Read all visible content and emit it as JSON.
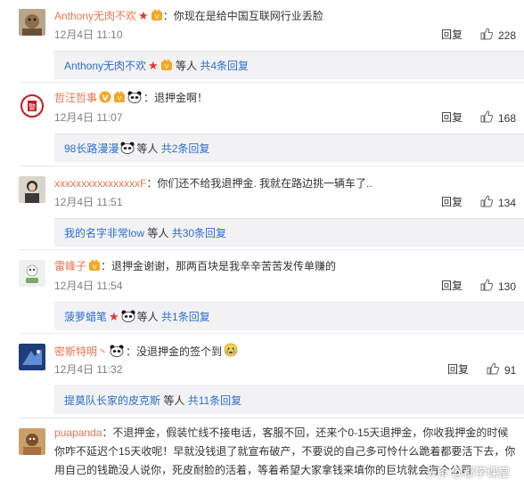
{
  "colors": {
    "username": "#eb7350",
    "link": "#2d6ec8",
    "meta": "#808080",
    "subbox_bg": "#f2f2f5"
  },
  "comments": [
    {
      "username": "Anthony无肉不欢",
      "text": "：你现在是给中国互联网行业丢脸",
      "time": "12月4日 11:10",
      "reply": "回复",
      "likes": "228",
      "sub": {
        "who": "Anthony无肉不欢",
        "etc": " 等人 ",
        "count": "共4条回复"
      }
    },
    {
      "username": "哲汪哲事",
      "text": "：退押金啊！",
      "time": "12月4日 11:07",
      "reply": "回复",
      "likes": "168",
      "sub": {
        "who": "98长路漫漫",
        "etc": "等人 ",
        "count": "共2条回复"
      }
    },
    {
      "username": "xxxxxxxxxxxxxxxxF",
      "text": "：你们还不给我退押金. 我就在路边挑一辆车了..",
      "time": "12月4日 11:51",
      "reply": "回复",
      "likes": "134",
      "sub": {
        "who": "我的名字非常low",
        "etc": " 等人 ",
        "count": "共30条回复"
      }
    },
    {
      "username": "雷峰子",
      "text": "：退押金谢谢，那两百块是我辛辛苦苦发传单赚的",
      "time": "12月4日 11:54",
      "reply": "回复",
      "likes": "130",
      "sub": {
        "who": "菠萝蜡笔",
        "etc": "等人 ",
        "count": "共1条回复"
      }
    },
    {
      "username": "密斯特明丶",
      "text": "：没退押金的签个到",
      "time": "12月4日 11:32",
      "reply": "回复",
      "likes": "91",
      "sub": {
        "who": "提莫队长家的皮克斯",
        "etc": " 等人 ",
        "count": "共11条回复"
      }
    },
    {
      "username": "puapanda",
      "text": "：不退押金，假装忙线不接电话，客服不回，还来个0-15天退押金，你收我押金的时候你咋不延迟个15天收呢！早就没钱退了就宣布破产，不要说的自己多可怜什么跪着都要活下去，你用自己的钱跪没人说你，死皮耐脸的活着，等着希望大家拿钱来填你的巨坑就会有个公司"
    }
  ],
  "watermark": {
    "text": "头条 @都学课堂"
  }
}
